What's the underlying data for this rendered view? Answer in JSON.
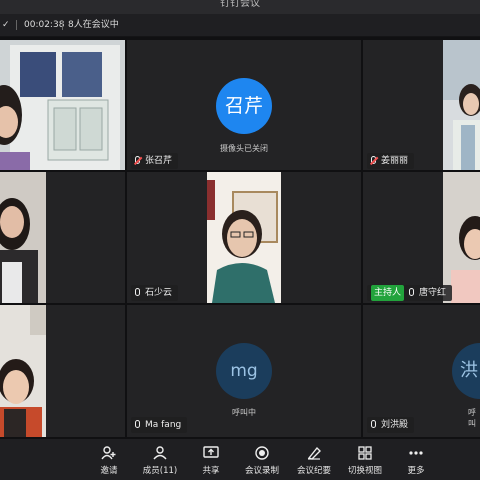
{
  "window": {
    "title": "钉钉会议"
  },
  "status": {
    "timer": "00:02:38",
    "participants": "8人在会议中"
  },
  "tiles": {
    "zhang": {
      "name": "张召芹",
      "avatar_text": "召芹",
      "status": "摄像头已关闭"
    },
    "jiang": {
      "name": "姜丽丽"
    },
    "shi": {
      "name": "石少云"
    },
    "tang": {
      "name": "唐守红",
      "badge": "主持人"
    },
    "mafang": {
      "name": "Ma fang",
      "avatar_text": "mg",
      "status": "呼叫中"
    },
    "liu": {
      "name": "刘洪殿",
      "avatar_text": "洪",
      "status": "呼叫"
    }
  },
  "toolbar": {
    "invite": "邀请",
    "members": "成员(11)",
    "share": "共享",
    "record": "会议录制",
    "minutes": "会议纪要",
    "switch_view": "切换视图",
    "more": "更多"
  },
  "icons": [
    "check-icon",
    "microphone-icon",
    "muted-microphone-icon",
    "invite-icon",
    "members-icon",
    "share-icon",
    "record-icon",
    "minutes-icon",
    "switch-view-icon",
    "more-icon"
  ]
}
